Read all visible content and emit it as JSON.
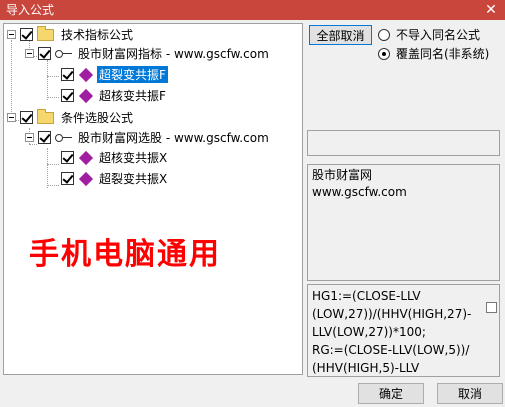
{
  "window": {
    "title": "导入公式",
    "close_glyph": "✕"
  },
  "tree": {
    "nodes": [
      {
        "label": "技术指标公式",
        "type": "folder",
        "checked": true
      },
      {
        "label": "股市财富网指标 - www.gscfw.com",
        "type": "key",
        "checked": true
      },
      {
        "label": "超裂变共振F",
        "type": "formula",
        "checked": true,
        "selected": true
      },
      {
        "label": "超核变共振F",
        "type": "formula",
        "checked": true
      },
      {
        "label": "条件选股公式",
        "type": "folder",
        "checked": true
      },
      {
        "label": "股市财富网选股 - www.gscfw.com",
        "type": "key",
        "checked": true
      },
      {
        "label": "超核变共振X",
        "type": "formula",
        "checked": true
      },
      {
        "label": "超裂变共振X",
        "type": "formula",
        "checked": true
      }
    ]
  },
  "watermark": "手机电脑通用",
  "options": {
    "cancel_all_label": "全部取消",
    "radio_no_import": "不导入同名公式",
    "radio_overwrite": "覆盖同名(非系统)",
    "selected": "overwrite"
  },
  "description": {
    "line1": "股市财富网",
    "line2": "www.gscfw.com"
  },
  "formula_preview": {
    "lines": [
      "HG1:=(CLOSE-LLV",
      "(LOW,27))/(HHV(HIGH,27)-",
      "LLV(LOW,27))*100;",
      "RG:=(CLOSE-LLV(LOW,5))/",
      "(HHV(HIGH,5)-LLV"
    ]
  },
  "footer": {
    "ok_label": "确定",
    "cancel_label": "取消"
  }
}
